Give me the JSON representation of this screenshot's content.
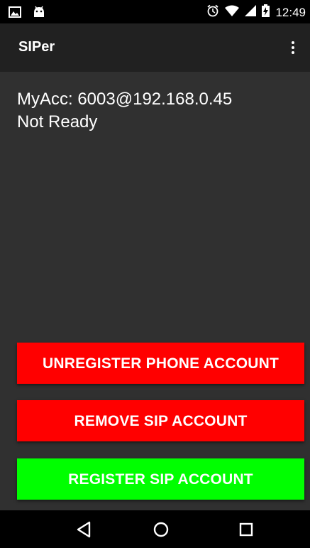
{
  "status_bar": {
    "time": "12:49",
    "left_icons": [
      "image-icon",
      "android-icon"
    ],
    "right_icons": [
      "alarm-icon",
      "wifi-icon",
      "signal-icon",
      "battery-icon"
    ]
  },
  "app_bar": {
    "title": "SIPer",
    "menu_icon": "more-vert-icon"
  },
  "content": {
    "account_line": "MyAcc: 6003@192.168.0.45",
    "status_line": "Not Ready"
  },
  "buttons": {
    "unregister_phone": "UNREGISTER PHONE ACCOUNT",
    "remove_sip": "REMOVE SIP ACCOUNT",
    "register_sip": "REGISTER SIP ACCOUNT"
  },
  "colors": {
    "red_button": "#ff0000",
    "green_button": "#00ff00",
    "background": "#303030",
    "app_bar": "#212121"
  },
  "nav_bar": {
    "icons": [
      "back-icon",
      "home-icon",
      "recents-icon"
    ]
  }
}
